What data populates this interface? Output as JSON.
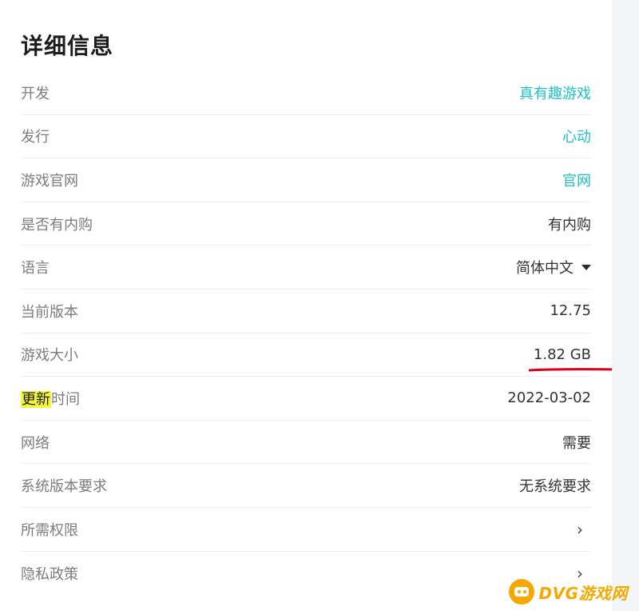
{
  "title": "详细信息",
  "rows": [
    {
      "label": "开发",
      "value": "真有趣游戏",
      "style": "link"
    },
    {
      "label": "发行",
      "value": "心动",
      "style": "link"
    },
    {
      "label": "游戏官网",
      "value": "官网",
      "style": "link"
    },
    {
      "label": "是否有内购",
      "value": "有内购",
      "style": "plain"
    },
    {
      "label": "语言",
      "value": "简体中文",
      "style": "dropdown"
    },
    {
      "label": "当前版本",
      "value": "12.75",
      "style": "plain"
    },
    {
      "label": "游戏大小",
      "value": "1.82 GB",
      "style": "plain"
    },
    {
      "label_highlight": "更新",
      "label_rest": "时间",
      "value": "2022-03-02",
      "style": "plain"
    },
    {
      "label": "网络",
      "value": "需要",
      "style": "plain"
    },
    {
      "label": "系统版本要求",
      "value": "无系统要求",
      "style": "plain"
    },
    {
      "label": "所需权限",
      "value": "",
      "style": "chevron"
    },
    {
      "label": "隐私政策",
      "value": "",
      "style": "chevron"
    }
  ],
  "icons": {
    "dropdown": "caret-down-icon",
    "chevron": "chevron-right-icon"
  },
  "watermark": {
    "text": "DVG游戏网"
  },
  "colors": {
    "link": "#1ec1c3",
    "highlight": "#f5f53a",
    "annotation": "#d9001b",
    "watermark": "#f5a800"
  }
}
